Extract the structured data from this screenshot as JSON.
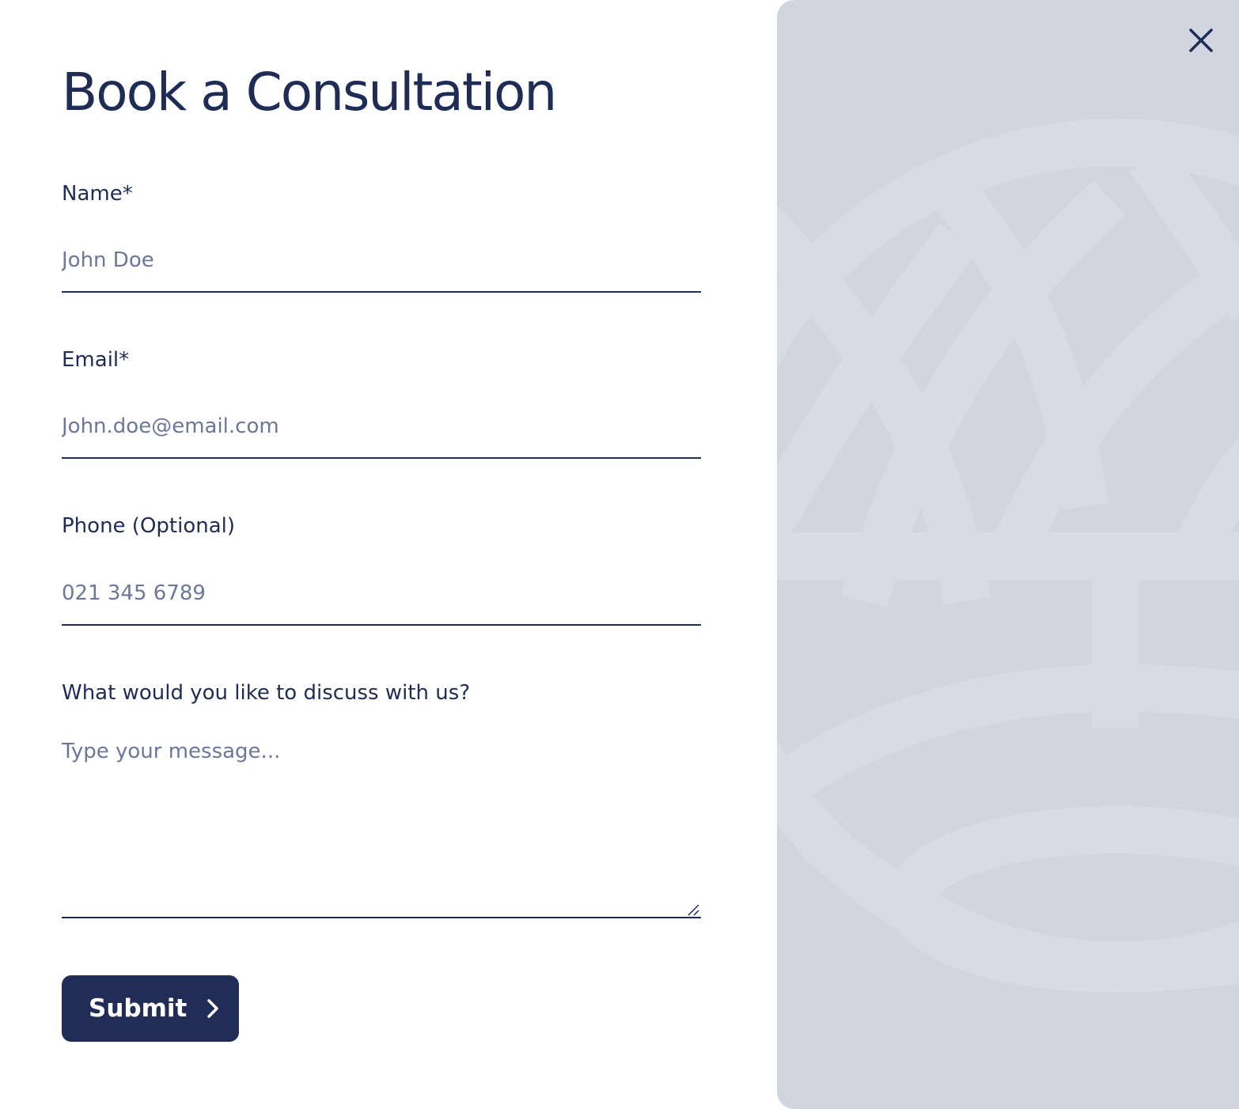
{
  "modal": {
    "title": "Book a Consultation",
    "close_icon": "close-icon"
  },
  "form": {
    "name": {
      "label": "Name*",
      "placeholder": "John Doe"
    },
    "email": {
      "label": "Email*",
      "placeholder": "John.doe@email.com"
    },
    "phone": {
      "label": "Phone (Optional)",
      "placeholder": "021 345 6789"
    },
    "message": {
      "label": "What would you like to discuss with us?",
      "placeholder": "Type your message..."
    },
    "submit": {
      "label": "Submit",
      "icon": "chevron-right-icon"
    }
  },
  "colors": {
    "primary": "#1f2c55",
    "placeholder": "#6c7799",
    "panel_background": "#d2d5df",
    "pattern": "#d8dbe4",
    "page_background": "#ffffff"
  }
}
